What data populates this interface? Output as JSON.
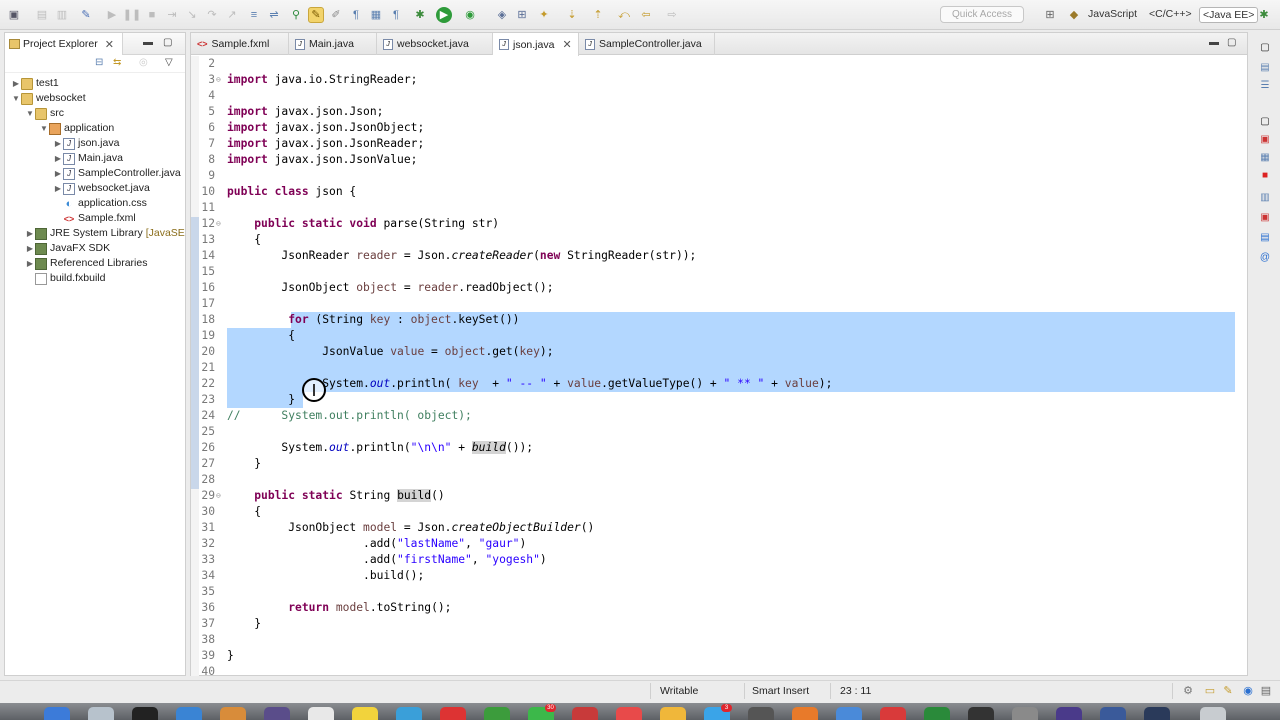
{
  "toolbar": {
    "quick_access_placeholder": "Quick Access",
    "perspectives": [
      "JavaScript",
      "<C/C++>",
      "<Java EE>"
    ]
  },
  "project_explorer": {
    "title": "Project Explorer",
    "tree": [
      {
        "label": "test1",
        "icon": "project-icon",
        "expanded": false,
        "level": 0
      },
      {
        "label": "websocket",
        "icon": "project-icon",
        "expanded": true,
        "level": 0
      },
      {
        "label": "src",
        "icon": "source-folder-icon",
        "expanded": true,
        "level": 1
      },
      {
        "label": "application",
        "icon": "package-icon",
        "expanded": true,
        "level": 2
      },
      {
        "label": "json.java",
        "icon": "java-file-icon",
        "expanded": false,
        "level": 3
      },
      {
        "label": "Main.java",
        "icon": "java-file-icon",
        "expanded": false,
        "level": 3
      },
      {
        "label": "SampleController.java",
        "icon": "java-file-icon",
        "expanded": false,
        "level": 3
      },
      {
        "label": "websocket.java",
        "icon": "java-file-icon",
        "expanded": false,
        "level": 3
      },
      {
        "label": "application.css",
        "icon": "css-file-icon",
        "expanded": null,
        "level": 3
      },
      {
        "label": "Sample.fxml",
        "icon": "fxml-file-icon",
        "expanded": null,
        "level": 3
      },
      {
        "label": "JRE System Library",
        "suffix": "[JavaSE",
        "icon": "library-icon",
        "expanded": false,
        "level": 1
      },
      {
        "label": "JavaFX SDK",
        "icon": "library-icon",
        "expanded": false,
        "level": 1
      },
      {
        "label": "Referenced Libraries",
        "icon": "library-icon",
        "expanded": false,
        "level": 1
      },
      {
        "label": "build.fxbuild",
        "icon": "file-icon",
        "expanded": null,
        "level": 1
      }
    ]
  },
  "editor": {
    "tabs": [
      {
        "label": "Sample.fxml",
        "icon": "fxml-file-icon",
        "active": false
      },
      {
        "label": "Main.java",
        "icon": "java-file-icon",
        "active": false
      },
      {
        "label": "websocket.java",
        "icon": "java-file-icon",
        "active": false
      },
      {
        "label": "json.java",
        "icon": "java-file-icon",
        "active": true
      },
      {
        "label": "SampleController.java",
        "icon": "java-file-icon",
        "active": false
      }
    ],
    "line_numbers": [
      "2",
      "3",
      "4",
      "5",
      "6",
      "7",
      "8",
      "9",
      "10",
      "11",
      "12",
      "13",
      "14",
      "15",
      "16",
      "17",
      "18",
      "19",
      "20",
      "21",
      "22",
      "23",
      "24",
      "25",
      "26",
      "27",
      "28",
      "29",
      "30",
      "31",
      "32",
      "33",
      "34",
      "35",
      "36",
      "37",
      "38",
      "39",
      "40"
    ],
    "code": {
      "l3": "import java.io.StringReader;",
      "l5": "import javax.json.Json;",
      "l6": "import javax.json.JsonObject;",
      "l7": "import javax.json.JsonReader;",
      "l8": "import javax.json.JsonValue;",
      "l10_kw": "public class",
      "l10_rest": " json {",
      "l12_kw": "public static void",
      "l12_rest": " parse(String str)",
      "l13": "{",
      "l14_a": "JsonReader ",
      "l14_var": "reader",
      "l14_b": " = Json.",
      "l14_m": "createReader",
      "l14_c": "(",
      "l14_kw": "new",
      "l14_d": " StringReader(str));",
      "l16_a": "JsonObject ",
      "l16_var": "object",
      "l16_b": " = ",
      "l16_var2": "reader",
      "l16_c": ".readObject();",
      "l18_kw": "for",
      "l18_a": " (String ",
      "l18_var": "key",
      "l18_b": " : ",
      "l18_var2": "object",
      "l18_c": ".keySet())",
      "l19": "{",
      "l20_a": "JsonValue ",
      "l20_var": "value",
      "l20_b": " = ",
      "l20_var2": "object",
      "l20_c": ".get(",
      "l20_var3": "key",
      "l20_d": ");",
      "l22_a": "System.",
      "l22_fld": "out",
      "l22_b": ".println( ",
      "l22_var": "key",
      "l22_c": "  + ",
      "l22_s1": "\" -- \"",
      "l22_d": " + ",
      "l22_var2": "value",
      "l22_e": ".getValueType() + ",
      "l22_s2": "\" ** \"",
      "l22_f": " + ",
      "l22_var3": "value",
      "l22_g": ");",
      "l23": "}",
      "l24": "//      System.out.println( object);",
      "l26_a": "System.",
      "l26_fld": "out",
      "l26_b": ".println(",
      "l26_s": "\"\\n\\n\"",
      "l26_c": " + ",
      "l26_m": "build",
      "l26_d": "());",
      "l27": "}",
      "l29_kw": "public static",
      "l29_a": " String ",
      "l29_m": "build",
      "l29_b": "()",
      "l30": "{",
      "l31_a": "JsonObject ",
      "l31_var": "model",
      "l31_b": " = Json.",
      "l31_m": "createObjectBuilder",
      "l31_c": "()",
      "l32_a": ".add(",
      "l32_s1": "\"lastName\"",
      "l32_b": ", ",
      "l32_s2": "\"gaur\"",
      "l32_c": ")",
      "l33_a": ".add(",
      "l33_s1": "\"firstName\"",
      "l33_b": ", ",
      "l33_s2": "\"yogesh\"",
      "l33_c": ")",
      "l34": ".build();",
      "l36_kw": "return",
      "l36_a": " ",
      "l36_var": "model",
      "l36_b": ".toString();",
      "l37": "}",
      "l39": "}"
    }
  },
  "status_bar": {
    "writable": "Writable",
    "insert_mode": "Smart Insert",
    "position": "23 : 11"
  },
  "colors": {
    "selection": "#b3d7ff",
    "keyword": "#7f0055",
    "string": "#2a00ff",
    "field": "#0000c0",
    "comment": "#3f7f5f",
    "local_variable": "#6a3e3e"
  }
}
